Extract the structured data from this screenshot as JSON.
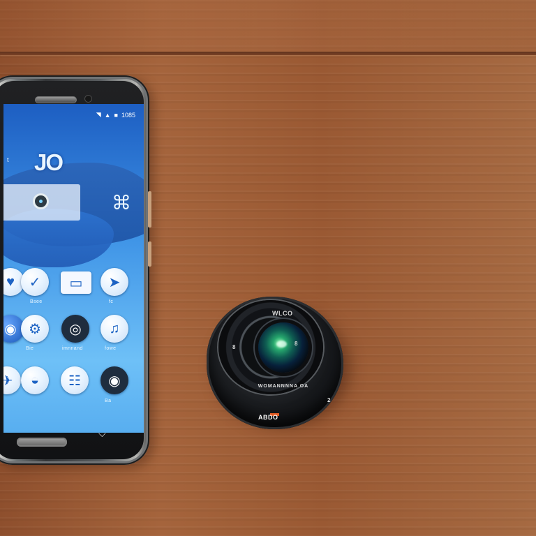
{
  "scene": {
    "table_color": "#9a5a35",
    "phone_frame_color": "#6c7274",
    "lens_color": "#111317"
  },
  "phone": {
    "status_time": "1085",
    "title_mark": "JO",
    "side_text": "t",
    "app_labels": [
      "Bsee",
      "fc",
      "Bie",
      "imnnand",
      "fowe",
      "Ba"
    ],
    "icon_names": [
      "wifi-icon",
      "signal-icon",
      "battery-icon",
      "clock-icon",
      "brand-logo-icon",
      "heart-app-icon",
      "check-app-icon",
      "gallery-app-icon",
      "compass-app-icon",
      "settings-app-icon",
      "camera-app-icon",
      "play-app-icon",
      "music-app-icon",
      "chat-app-icon",
      "lens-app-icon",
      "home-button-icon",
      "navigation-arrow-icon"
    ]
  },
  "lens": {
    "top_label": "WLCO",
    "left_label": "8",
    "right_label": "8",
    "ring_text": "WOMANNNNA OA",
    "bottom_text": "ABDO",
    "right_mark": "2"
  }
}
